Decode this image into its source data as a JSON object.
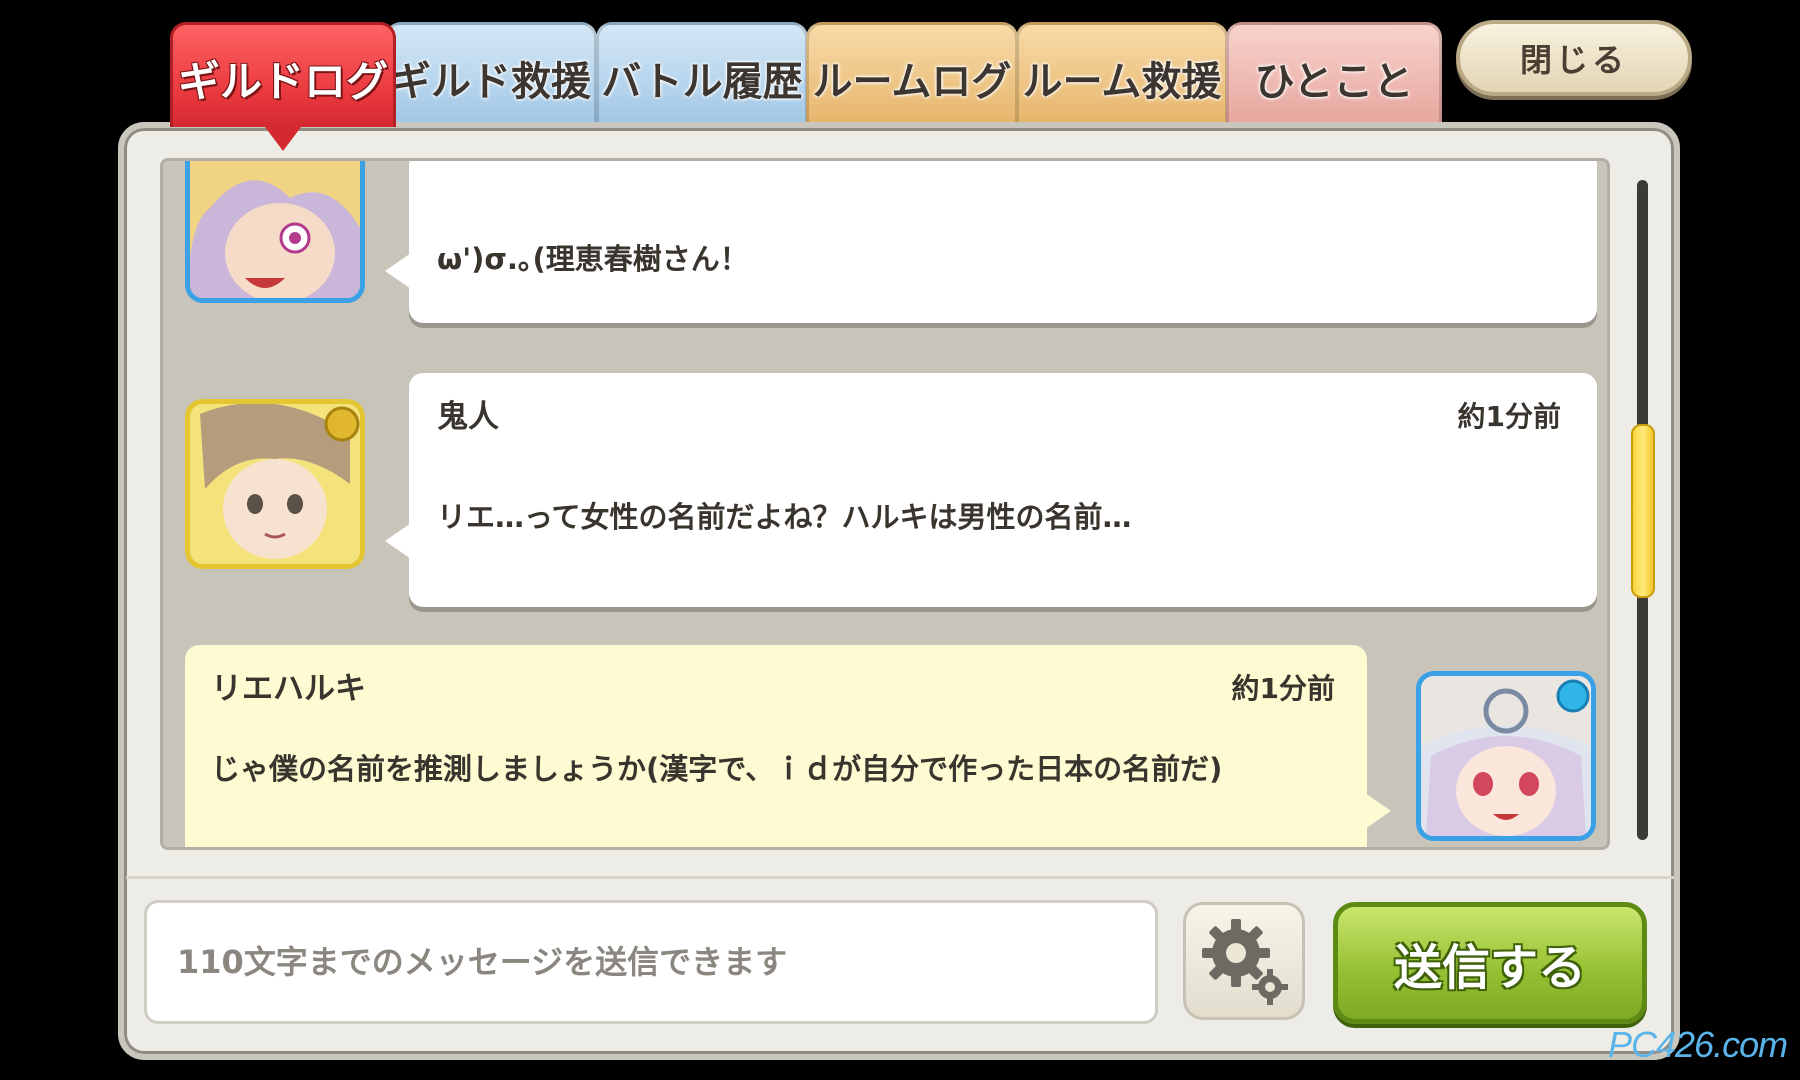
{
  "tabs": [
    {
      "label": "ギルドログ",
      "active": true
    },
    {
      "label": "ギルド救援",
      "active": false
    },
    {
      "label": "バトル履歴",
      "active": false
    },
    {
      "label": "ルームログ",
      "active": false
    },
    {
      "label": "ルーム救援",
      "active": false
    },
    {
      "label": "ひとこと",
      "active": false
    }
  ],
  "close_label": "閉じる",
  "messages": [
    {
      "name": "",
      "time": "",
      "text": "ω')σ.｡(理恵春樹さん！",
      "side": "left"
    },
    {
      "name": "鬼人",
      "time": "約1分前",
      "text": "リエ…って女性の名前だよね？ハルキは男性の名前…",
      "side": "left"
    },
    {
      "name": "リエハルキ",
      "time": "約1分前",
      "text": "じゃ僕の名前を推測しましょうか(漢字で、ｉｄが自分で作った日本の名前だ)",
      "side": "right"
    }
  ],
  "input": {
    "placeholder": "110文字までのメッセージを送信できます",
    "value": ""
  },
  "send_label": "送信する",
  "watermark": "PC426.com",
  "colors": {
    "active_tab": "#e8373d",
    "send_button": "#98c234",
    "own_bubble": "#fdfbd2",
    "scroll_thumb": "#f7d233"
  }
}
